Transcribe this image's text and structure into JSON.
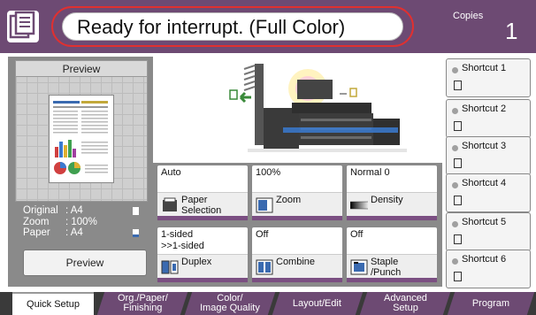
{
  "header": {
    "status": "Ready for interrupt. (Full Color)",
    "copies_label": "Copies",
    "copies_value": "1"
  },
  "preview": {
    "title": "Preview",
    "button": "Preview",
    "info": [
      {
        "label": "Original",
        "value": ": A4"
      },
      {
        "label": "Zoom",
        "value": ": 100%"
      },
      {
        "label": "Paper",
        "value": ": A4"
      }
    ]
  },
  "tiles": [
    {
      "value": "Auto",
      "label": "Paper\nSelection",
      "icon": "paper-tray-icon"
    },
    {
      "value": "100%",
      "label": "Zoom",
      "icon": "zoom-icon"
    },
    {
      "value": "Normal 0",
      "label": "Density",
      "icon": "density-icon"
    },
    {
      "value": "1-sided\n>>1-sided",
      "label": "Duplex",
      "icon": "duplex-icon"
    },
    {
      "value": "Off",
      "label": "Combine",
      "icon": "combine-icon"
    },
    {
      "value": "Off",
      "label": "Staple\n/Punch",
      "icon": "staple-icon"
    }
  ],
  "shortcuts": [
    {
      "label": "Shortcut 1"
    },
    {
      "label": "Shortcut 2"
    },
    {
      "label": "Shortcut 3"
    },
    {
      "label": "Shortcut 4"
    },
    {
      "label": "Shortcut 5"
    },
    {
      "label": "Shortcut 6"
    }
  ],
  "tabs": [
    {
      "label": "Quick Setup"
    },
    {
      "label": "Org./Paper/\nFinishing"
    },
    {
      "label": "Color/\nImage Quality"
    },
    {
      "label": "Layout/Edit"
    },
    {
      "label": "Advanced\nSetup"
    },
    {
      "label": "Program"
    }
  ],
  "colors": {
    "accent": "#6d4a73",
    "highlight_ring": "#e03030"
  }
}
